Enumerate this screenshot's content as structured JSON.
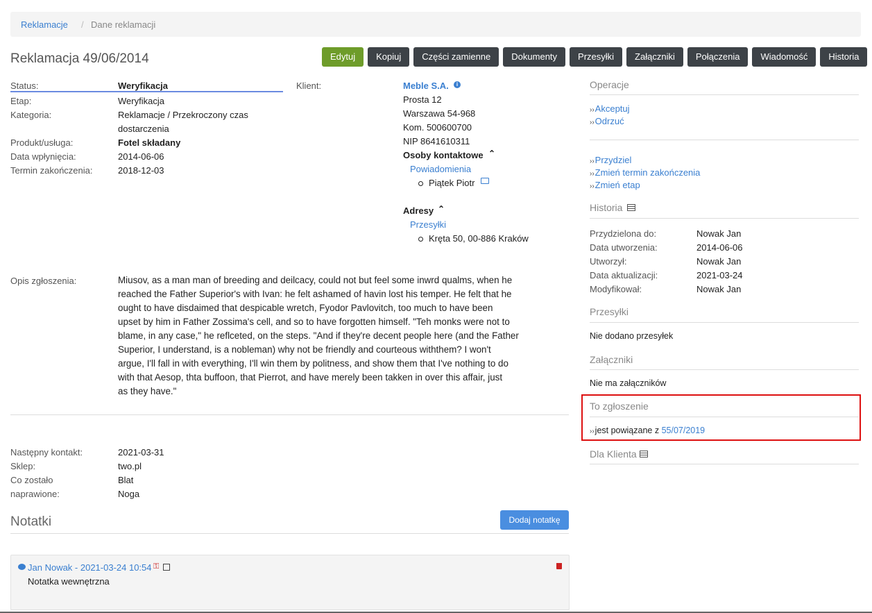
{
  "breadcrumb": {
    "root": "Reklamacje",
    "separator": "/",
    "current": "Dane reklamacji"
  },
  "title": "Reklamacja 49/06/2014",
  "toolbar": {
    "edit": "Edytuj",
    "copy": "Kopiuj",
    "parts": "Części zamienne",
    "documents": "Dokumenty",
    "shipments": "Przesyłki",
    "attachments": "Załączniki",
    "connections": "Połączenia",
    "messages": "Wiadomość",
    "history": "Historia"
  },
  "details": {
    "status_label": "Status:",
    "status_value": "Weryfikacja",
    "stage_label": "Etap:",
    "stage_value": "Weryfikacja",
    "category_label": "Kategoria:",
    "category_value_1": "Reklamacje / Przekroczony czas",
    "category_value_2": "dostarczenia",
    "product_label": "Produkt/usługa:",
    "product_value": "Fotel składany",
    "received_label": "Data wpłynięcia:",
    "received_value": "2014-06-06",
    "deadline_label": "Termin zakończenia:",
    "deadline_value": "2018-12-03"
  },
  "client": {
    "label": "Klient:",
    "name": "Meble S.A.",
    "street": "Prosta 12",
    "city": "Warszawa 54-968",
    "phone": "Kom. 500600700",
    "nip": "NIP 8641610311",
    "contacts_header": "Osoby kontaktowe",
    "notifications_link": "Powiadomienia",
    "contact_person": "Piątek Piotr",
    "addresses_header": "Adresy",
    "shipments_link": "Przesyłki",
    "address": "Kręta 50, 00-886 Kraków"
  },
  "description": {
    "label": "Opis zgłoszenia:",
    "lines": [
      "Miusov, as a man man of breeding and deilcacy, could not but feel some inwrd qualms, when he",
      "reached the Father Superior's with Ivan: he felt ashamed of havin lost his temper. He felt that he",
      "ought to have disdaimed that despicable wretch, Fyodor Pavlovitch, too much to have been",
      "upset by him in Father Zossima's cell, and so to have forgotten himself. \"Teh monks were not to",
      "blame, in any case,\" he reflceted, on the steps. \"And if they're decent people here (and the Father",
      "Superior, I understand, is a nobleman) why not be friendly and courteous withthem? I won't",
      "argue, I'll fall in with everything, I'll win them by politness, and show them that I've nothing to do",
      "with that Aesop, thta buffoon, that Pierrot, and have merely been takken in over this affair, just",
      "as they have.\""
    ]
  },
  "extra": {
    "next_contact_label": "Następny kontakt:",
    "next_contact_value": "2021-03-31",
    "shop_label": "Sklep:",
    "shop_value": "two.pl",
    "repaired_label_1": "Co zostało",
    "repaired_label_2": "naprawione:",
    "repaired_value_1": "Blat",
    "repaired_value_2": "Noga"
  },
  "notes": {
    "header": "Notatki",
    "add_button": "Dodaj notatkę",
    "author_line": "Jan Nowak - 2021-03-24 10:54",
    "text": "Notatka wewnętrzna"
  },
  "sidebar": {
    "operations_header": "Operacje",
    "accept": "Akceptuj",
    "reject": "Odrzuć",
    "assign": "Przydziel",
    "change_deadline": "Zmień termin zakończenia",
    "change_stage": "Zmień etap",
    "history_header": "Historia",
    "assigned_label": "Przydzielona do:",
    "assigned_value": "Nowak Jan",
    "created_label": "Data utworzenia:",
    "created_value": "2014-06-06",
    "creator_label": "Utworzył:",
    "creator_value": "Nowak Jan",
    "updated_label": "Data aktualizacji:",
    "updated_value": "2021-03-24",
    "modifier_label": "Modyfikował:",
    "modifier_value": "Nowak Jan",
    "shipments_header": "Przesyłki",
    "shipments_empty": "Nie dodano przesyłek",
    "attachments_header": "Załączniki",
    "attachments_empty": "Nie ma załączników",
    "this_ticket_header": "To zgłoszenie",
    "related_prefix": "jest powiązane z",
    "related_link": "55/07/2019",
    "for_client_header": "Dla Klienta"
  },
  "colors": {
    "link": "#3a7fd0",
    "edit_button": "#6e9c2a",
    "dark_button": "#3d4247",
    "primary_button": "#4a8ee0",
    "highlight": "#dd1111"
  }
}
